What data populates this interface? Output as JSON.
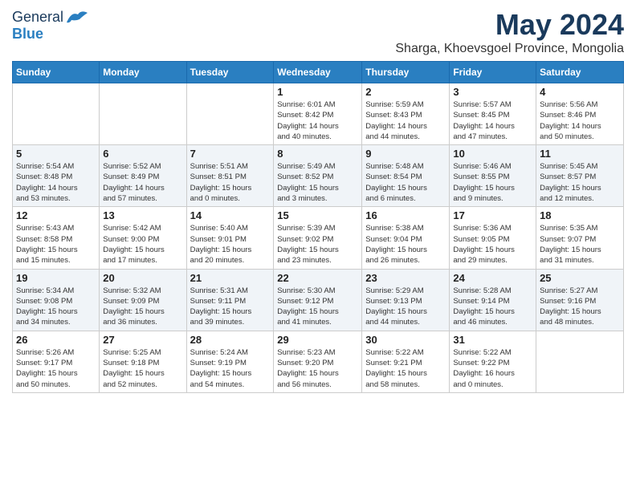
{
  "logo": {
    "general": "General",
    "blue": "Blue"
  },
  "title": "May 2024",
  "location": "Sharga, Khoevsgoel Province, Mongolia",
  "days_of_week": [
    "Sunday",
    "Monday",
    "Tuesday",
    "Wednesday",
    "Thursday",
    "Friday",
    "Saturday"
  ],
  "weeks": [
    [
      {
        "day": "",
        "info": ""
      },
      {
        "day": "",
        "info": ""
      },
      {
        "day": "",
        "info": ""
      },
      {
        "day": "1",
        "info": "Sunrise: 6:01 AM\nSunset: 8:42 PM\nDaylight: 14 hours\nand 40 minutes."
      },
      {
        "day": "2",
        "info": "Sunrise: 5:59 AM\nSunset: 8:43 PM\nDaylight: 14 hours\nand 44 minutes."
      },
      {
        "day": "3",
        "info": "Sunrise: 5:57 AM\nSunset: 8:45 PM\nDaylight: 14 hours\nand 47 minutes."
      },
      {
        "day": "4",
        "info": "Sunrise: 5:56 AM\nSunset: 8:46 PM\nDaylight: 14 hours\nand 50 minutes."
      }
    ],
    [
      {
        "day": "5",
        "info": "Sunrise: 5:54 AM\nSunset: 8:48 PM\nDaylight: 14 hours\nand 53 minutes."
      },
      {
        "day": "6",
        "info": "Sunrise: 5:52 AM\nSunset: 8:49 PM\nDaylight: 14 hours\nand 57 minutes."
      },
      {
        "day": "7",
        "info": "Sunrise: 5:51 AM\nSunset: 8:51 PM\nDaylight: 15 hours\nand 0 minutes."
      },
      {
        "day": "8",
        "info": "Sunrise: 5:49 AM\nSunset: 8:52 PM\nDaylight: 15 hours\nand 3 minutes."
      },
      {
        "day": "9",
        "info": "Sunrise: 5:48 AM\nSunset: 8:54 PM\nDaylight: 15 hours\nand 6 minutes."
      },
      {
        "day": "10",
        "info": "Sunrise: 5:46 AM\nSunset: 8:55 PM\nDaylight: 15 hours\nand 9 minutes."
      },
      {
        "day": "11",
        "info": "Sunrise: 5:45 AM\nSunset: 8:57 PM\nDaylight: 15 hours\nand 12 minutes."
      }
    ],
    [
      {
        "day": "12",
        "info": "Sunrise: 5:43 AM\nSunset: 8:58 PM\nDaylight: 15 hours\nand 15 minutes."
      },
      {
        "day": "13",
        "info": "Sunrise: 5:42 AM\nSunset: 9:00 PM\nDaylight: 15 hours\nand 17 minutes."
      },
      {
        "day": "14",
        "info": "Sunrise: 5:40 AM\nSunset: 9:01 PM\nDaylight: 15 hours\nand 20 minutes."
      },
      {
        "day": "15",
        "info": "Sunrise: 5:39 AM\nSunset: 9:02 PM\nDaylight: 15 hours\nand 23 minutes."
      },
      {
        "day": "16",
        "info": "Sunrise: 5:38 AM\nSunset: 9:04 PM\nDaylight: 15 hours\nand 26 minutes."
      },
      {
        "day": "17",
        "info": "Sunrise: 5:36 AM\nSunset: 9:05 PM\nDaylight: 15 hours\nand 29 minutes."
      },
      {
        "day": "18",
        "info": "Sunrise: 5:35 AM\nSunset: 9:07 PM\nDaylight: 15 hours\nand 31 minutes."
      }
    ],
    [
      {
        "day": "19",
        "info": "Sunrise: 5:34 AM\nSunset: 9:08 PM\nDaylight: 15 hours\nand 34 minutes."
      },
      {
        "day": "20",
        "info": "Sunrise: 5:32 AM\nSunset: 9:09 PM\nDaylight: 15 hours\nand 36 minutes."
      },
      {
        "day": "21",
        "info": "Sunrise: 5:31 AM\nSunset: 9:11 PM\nDaylight: 15 hours\nand 39 minutes."
      },
      {
        "day": "22",
        "info": "Sunrise: 5:30 AM\nSunset: 9:12 PM\nDaylight: 15 hours\nand 41 minutes."
      },
      {
        "day": "23",
        "info": "Sunrise: 5:29 AM\nSunset: 9:13 PM\nDaylight: 15 hours\nand 44 minutes."
      },
      {
        "day": "24",
        "info": "Sunrise: 5:28 AM\nSunset: 9:14 PM\nDaylight: 15 hours\nand 46 minutes."
      },
      {
        "day": "25",
        "info": "Sunrise: 5:27 AM\nSunset: 9:16 PM\nDaylight: 15 hours\nand 48 minutes."
      }
    ],
    [
      {
        "day": "26",
        "info": "Sunrise: 5:26 AM\nSunset: 9:17 PM\nDaylight: 15 hours\nand 50 minutes."
      },
      {
        "day": "27",
        "info": "Sunrise: 5:25 AM\nSunset: 9:18 PM\nDaylight: 15 hours\nand 52 minutes."
      },
      {
        "day": "28",
        "info": "Sunrise: 5:24 AM\nSunset: 9:19 PM\nDaylight: 15 hours\nand 54 minutes."
      },
      {
        "day": "29",
        "info": "Sunrise: 5:23 AM\nSunset: 9:20 PM\nDaylight: 15 hours\nand 56 minutes."
      },
      {
        "day": "30",
        "info": "Sunrise: 5:22 AM\nSunset: 9:21 PM\nDaylight: 15 hours\nand 58 minutes."
      },
      {
        "day": "31",
        "info": "Sunrise: 5:22 AM\nSunset: 9:22 PM\nDaylight: 16 hours\nand 0 minutes."
      },
      {
        "day": "",
        "info": ""
      }
    ]
  ]
}
